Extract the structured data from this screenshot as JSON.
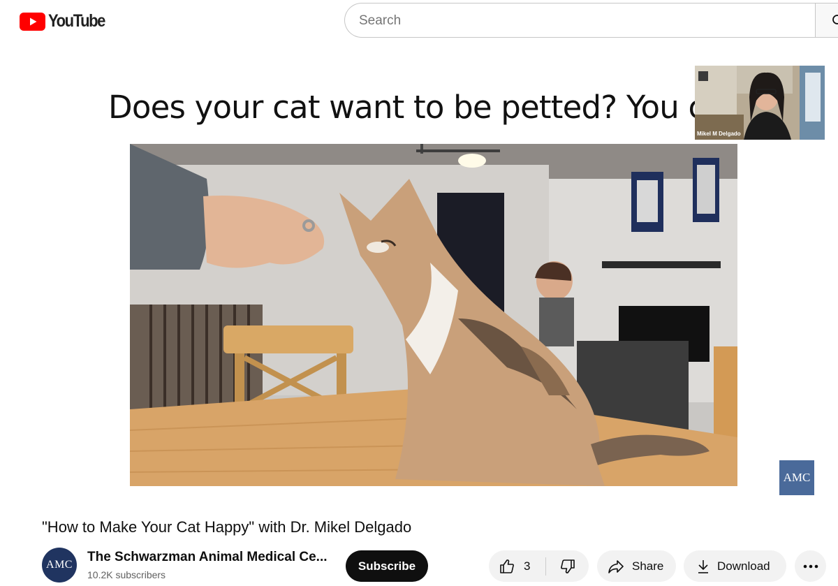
{
  "header": {
    "logo_text": "YouTube",
    "search_placeholder": "Search"
  },
  "video": {
    "slide_title": "Does your cat want to be petted? You can",
    "webcam_label": "Mikel M Delgado",
    "badge_text": "AMC"
  },
  "info": {
    "title": "\"How to Make Your Cat Happy\" with Dr. Mikel Delgado",
    "channel_avatar_text": "AMC",
    "channel_name": "The Schwarzman Animal Medical Ce...",
    "subscribers": "10.2K subscribers",
    "subscribe_label": "Subscribe",
    "like_count": "3",
    "share_label": "Share",
    "download_label": "Download"
  },
  "colors": {
    "youtube_red": "#FF0000",
    "amc_blue": "#4a6a9a",
    "avatar_navy": "#203460"
  }
}
